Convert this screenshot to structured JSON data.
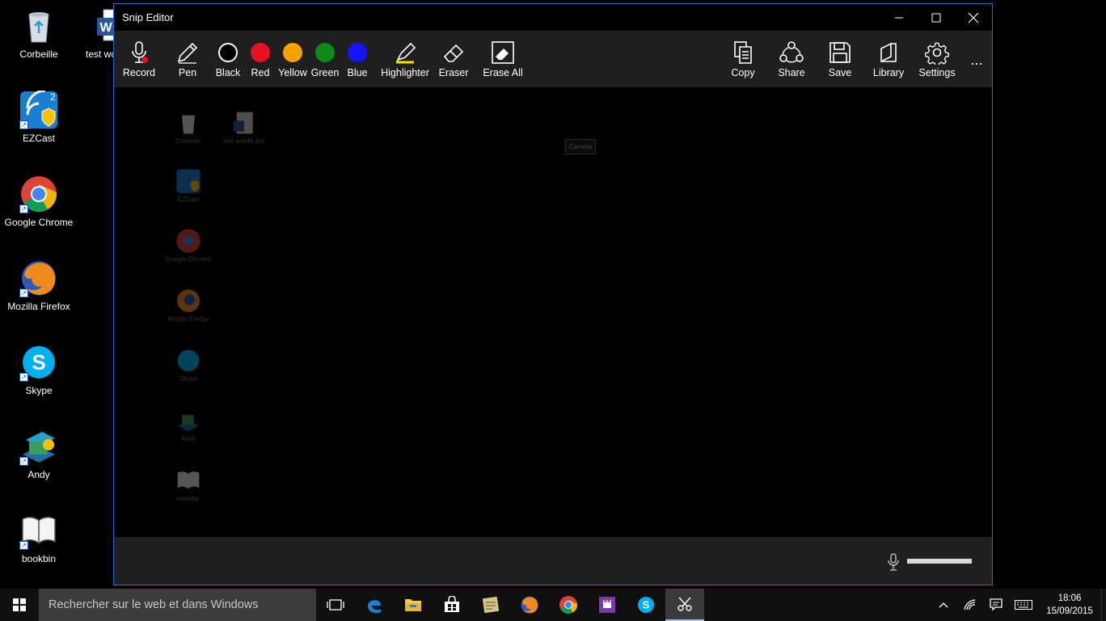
{
  "desktop": {
    "icons": [
      {
        "label": "Corbeille",
        "icon": "recycle-bin-icon"
      },
      {
        "label": "test wo",
        "icon": "word-document-icon"
      },
      {
        "label": "EZCast",
        "icon": "ezcast-icon"
      },
      {
        "label": "Google Chrome",
        "icon": "chrome-icon"
      },
      {
        "label": "Mozilla Firefox",
        "icon": "firefox-icon"
      },
      {
        "label": "Skype",
        "icon": "skype-icon"
      },
      {
        "label": "Andy",
        "icon": "andy-icon"
      },
      {
        "label": "bookbin",
        "icon": "bookbin-icon"
      }
    ]
  },
  "window": {
    "title": "Snip Editor",
    "tools_left": [
      {
        "label": "Record",
        "icon": "microphone-icon"
      },
      {
        "label": "Pen",
        "icon": "pen-icon"
      },
      {
        "label": "Black",
        "icon": "color-black-icon",
        "color": "#000000"
      },
      {
        "label": "Red",
        "icon": "color-red-icon",
        "color": "#e81123"
      },
      {
        "label": "Yellow",
        "icon": "color-yellow-icon",
        "color": "#f7a100"
      },
      {
        "label": "Green",
        "icon": "color-green-icon",
        "color": "#10891a"
      },
      {
        "label": "Blue",
        "icon": "color-blue-icon",
        "color": "#1414ff"
      },
      {
        "label": "Highlighter",
        "icon": "highlighter-icon"
      },
      {
        "label": "Eraser",
        "icon": "eraser-icon"
      },
      {
        "label": "Erase All",
        "icon": "erase-all-icon"
      }
    ],
    "tools_right": [
      {
        "label": "Copy",
        "icon": "copy-icon"
      },
      {
        "label": "Share",
        "icon": "share-icon"
      },
      {
        "label": "Save",
        "icon": "save-icon"
      },
      {
        "label": "Library",
        "icon": "library-icon"
      },
      {
        "label": "Settings",
        "icon": "settings-icon"
      }
    ],
    "more_label": "...",
    "snip_ghost_icons": [
      {
        "label": "Corbeille"
      },
      {
        "label": "test word8.doc"
      },
      {
        "label": "EZCast"
      },
      {
        "label": "Google Chrome"
      },
      {
        "label": "Mozilla Firefox"
      },
      {
        "label": "Skype"
      },
      {
        "label": "Andy"
      },
      {
        "label": "bookbin"
      }
    ],
    "tooltip": "Camera"
  },
  "taskbar": {
    "search_placeholder": "Rechercher sur le web et dans Windows",
    "time": "18:06",
    "date": "15/09/2015"
  },
  "colors": {
    "accent": "#2b6bd6",
    "toolbar_bg": "#1f1f1f",
    "taskbar_bg": "#101010"
  }
}
